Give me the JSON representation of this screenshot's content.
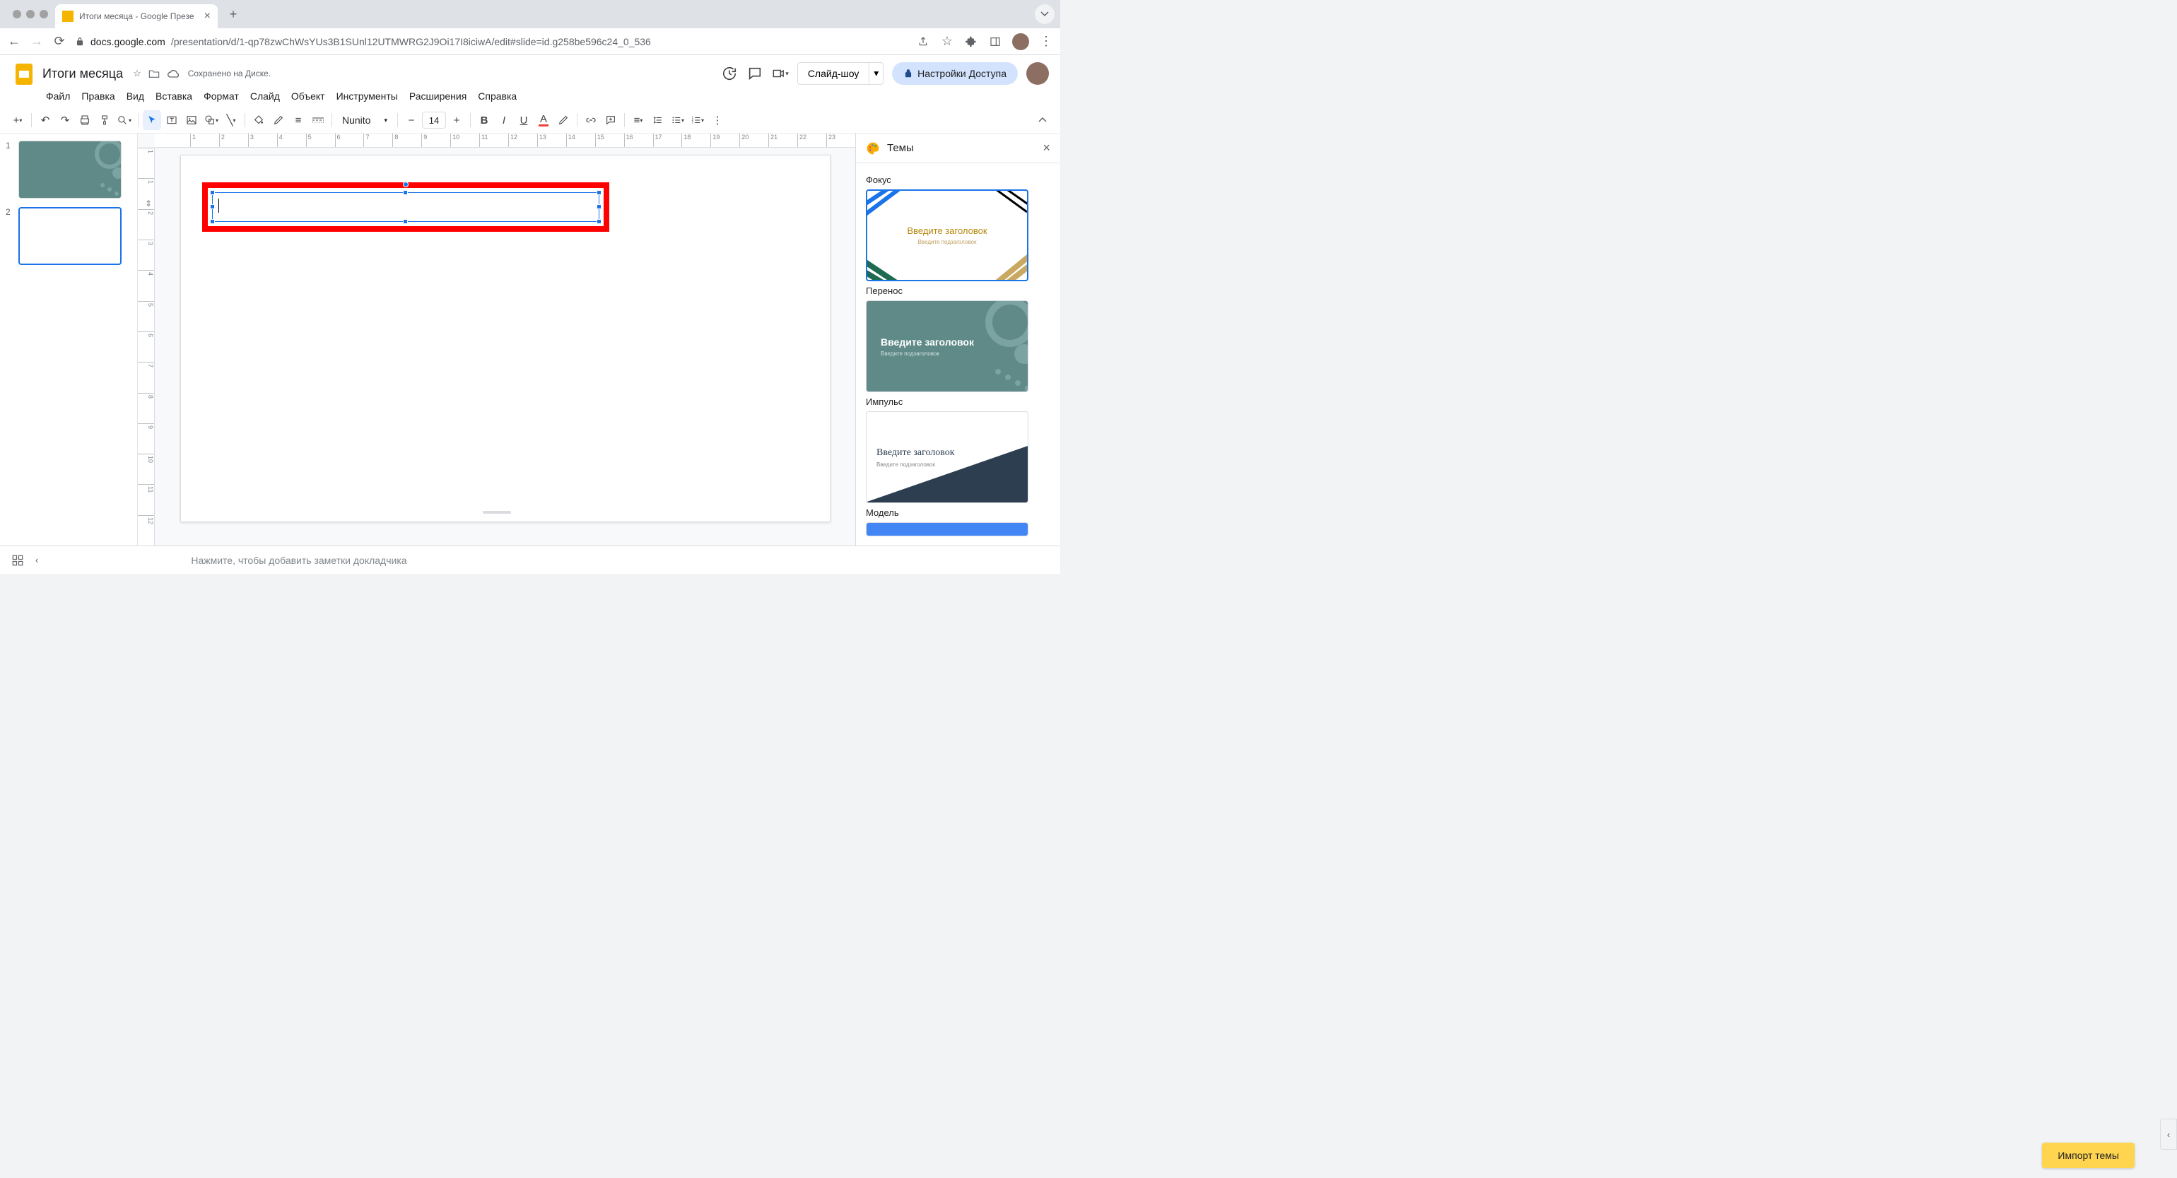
{
  "browser": {
    "tab_title": "Итоги месяца - Google Презе",
    "url_host": "docs.google.com",
    "url_path": "/presentation/d/1-qp78zwChWsYUs3B1SUnl12UTMWRG2J9Oi17I8iciwA/edit#slide=id.g258be596c24_0_536"
  },
  "doc": {
    "title": "Итоги месяца",
    "saved": "Сохранено на Диске."
  },
  "menus": [
    "Файл",
    "Правка",
    "Вид",
    "Вставка",
    "Формат",
    "Слайд",
    "Объект",
    "Инструменты",
    "Расширения",
    "Справка"
  ],
  "header": {
    "slideshow": "Слайд-шоу",
    "share": "Настройки Доступа"
  },
  "toolbar": {
    "font": "Nunito",
    "size": "14"
  },
  "slides": [
    {
      "num": "1"
    },
    {
      "num": "2"
    }
  ],
  "ruler_h": [
    "1",
    "2",
    "3",
    "4",
    "5",
    "6",
    "7",
    "8",
    "9",
    "10",
    "11",
    "12",
    "13",
    "14",
    "15",
    "16",
    "17",
    "18",
    "19",
    "20",
    "21",
    "22",
    "23"
  ],
  "ruler_v": [
    "1",
    "1",
    "2",
    "3",
    "4",
    "5",
    "6",
    "7",
    "8",
    "9",
    "10",
    "11",
    "12"
  ],
  "themes_panel": {
    "title": "Темы",
    "items": [
      {
        "name": "Фокус",
        "title_ph": "Введите заголовок",
        "sub_ph": "Введите подзаголовок"
      },
      {
        "name": "Перенос",
        "title_ph": "Введите заголовок",
        "sub_ph": "Введите подзаголовок"
      },
      {
        "name": "Импульс",
        "title_ph": "Введите заголовок",
        "sub_ph": "Введите подзаголовок"
      },
      {
        "name": "Модель",
        "title_ph": "",
        "sub_ph": ""
      }
    ],
    "import": "Импорт темы"
  },
  "notes_placeholder": "Нажмите, чтобы добавить заметки докладчика"
}
